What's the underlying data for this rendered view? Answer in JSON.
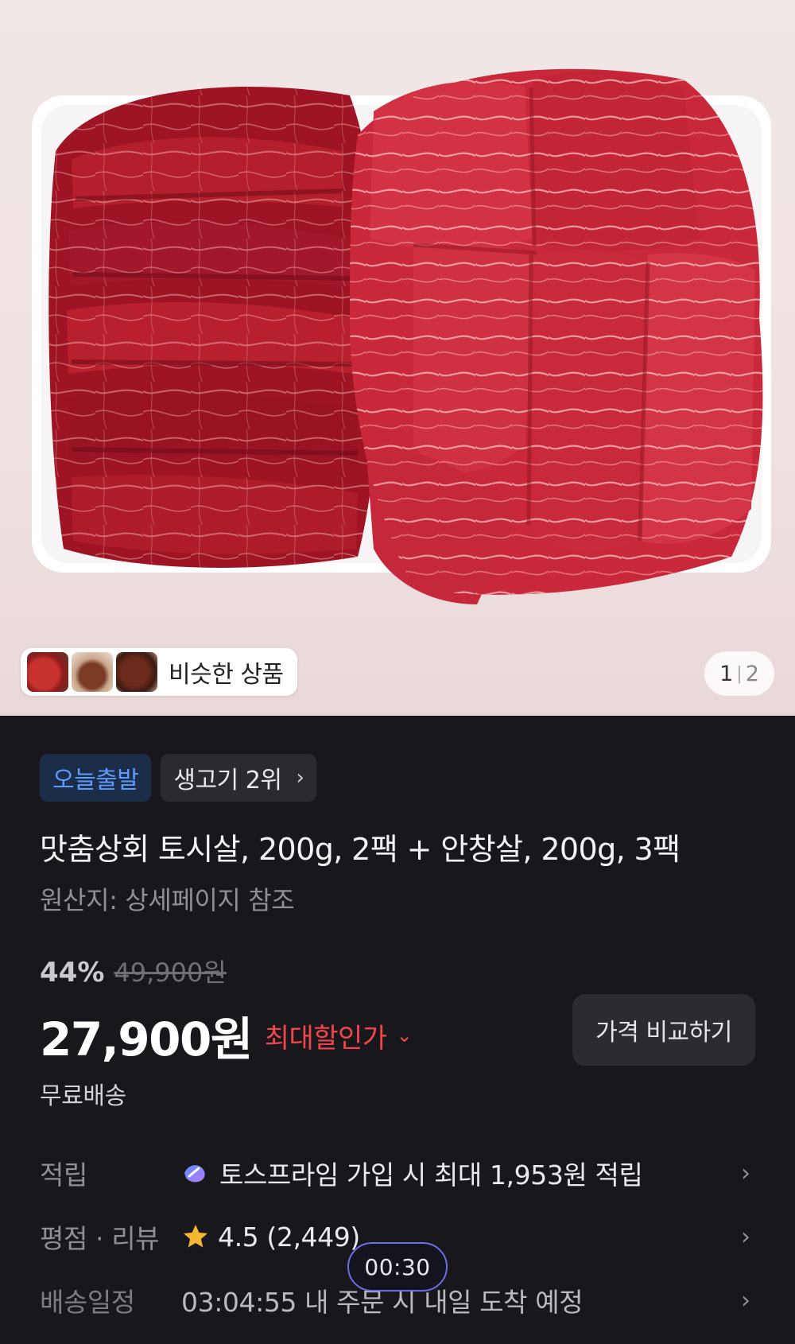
{
  "gallery": {
    "similar_label": "비슷한 상품",
    "pager_current": "1",
    "pager_sep": "|",
    "pager_total": "2"
  },
  "badges": {
    "today": "오늘출발",
    "rank": "생고기 2위"
  },
  "product": {
    "title": "맛춤상회 토시살, 200g, 2팩 + 안창살, 200g, 3팩",
    "origin": "원산지: 상세페이지 참조",
    "discount_rate": "44%",
    "original_price": "49,900원",
    "price": "27,900원",
    "max_discount_label": "최대할인가",
    "compare_button": "가격 비교하기",
    "shipping": "무료배송"
  },
  "info_rows": {
    "points": {
      "label": "적립",
      "value": "토스프라임 가입 시 최대 1,953원 적립"
    },
    "rating": {
      "label": "평점 · 리뷰",
      "value": "4.5 (2,449)"
    },
    "delivery": {
      "label": "배송일정",
      "value": "03:04:55 내 주문 시 내일 도착 예정"
    }
  },
  "overlay": {
    "timer": "00:30"
  },
  "colors": {
    "background": "#17171c",
    "accent_blue": "#5e9bff",
    "sale_red": "#f0464b",
    "star": "#f5b731",
    "timer_border": "#6d6de6"
  },
  "icons": [
    "chevron-right-icon",
    "chevron-down-icon",
    "toss-prime-icon",
    "star-icon"
  ]
}
